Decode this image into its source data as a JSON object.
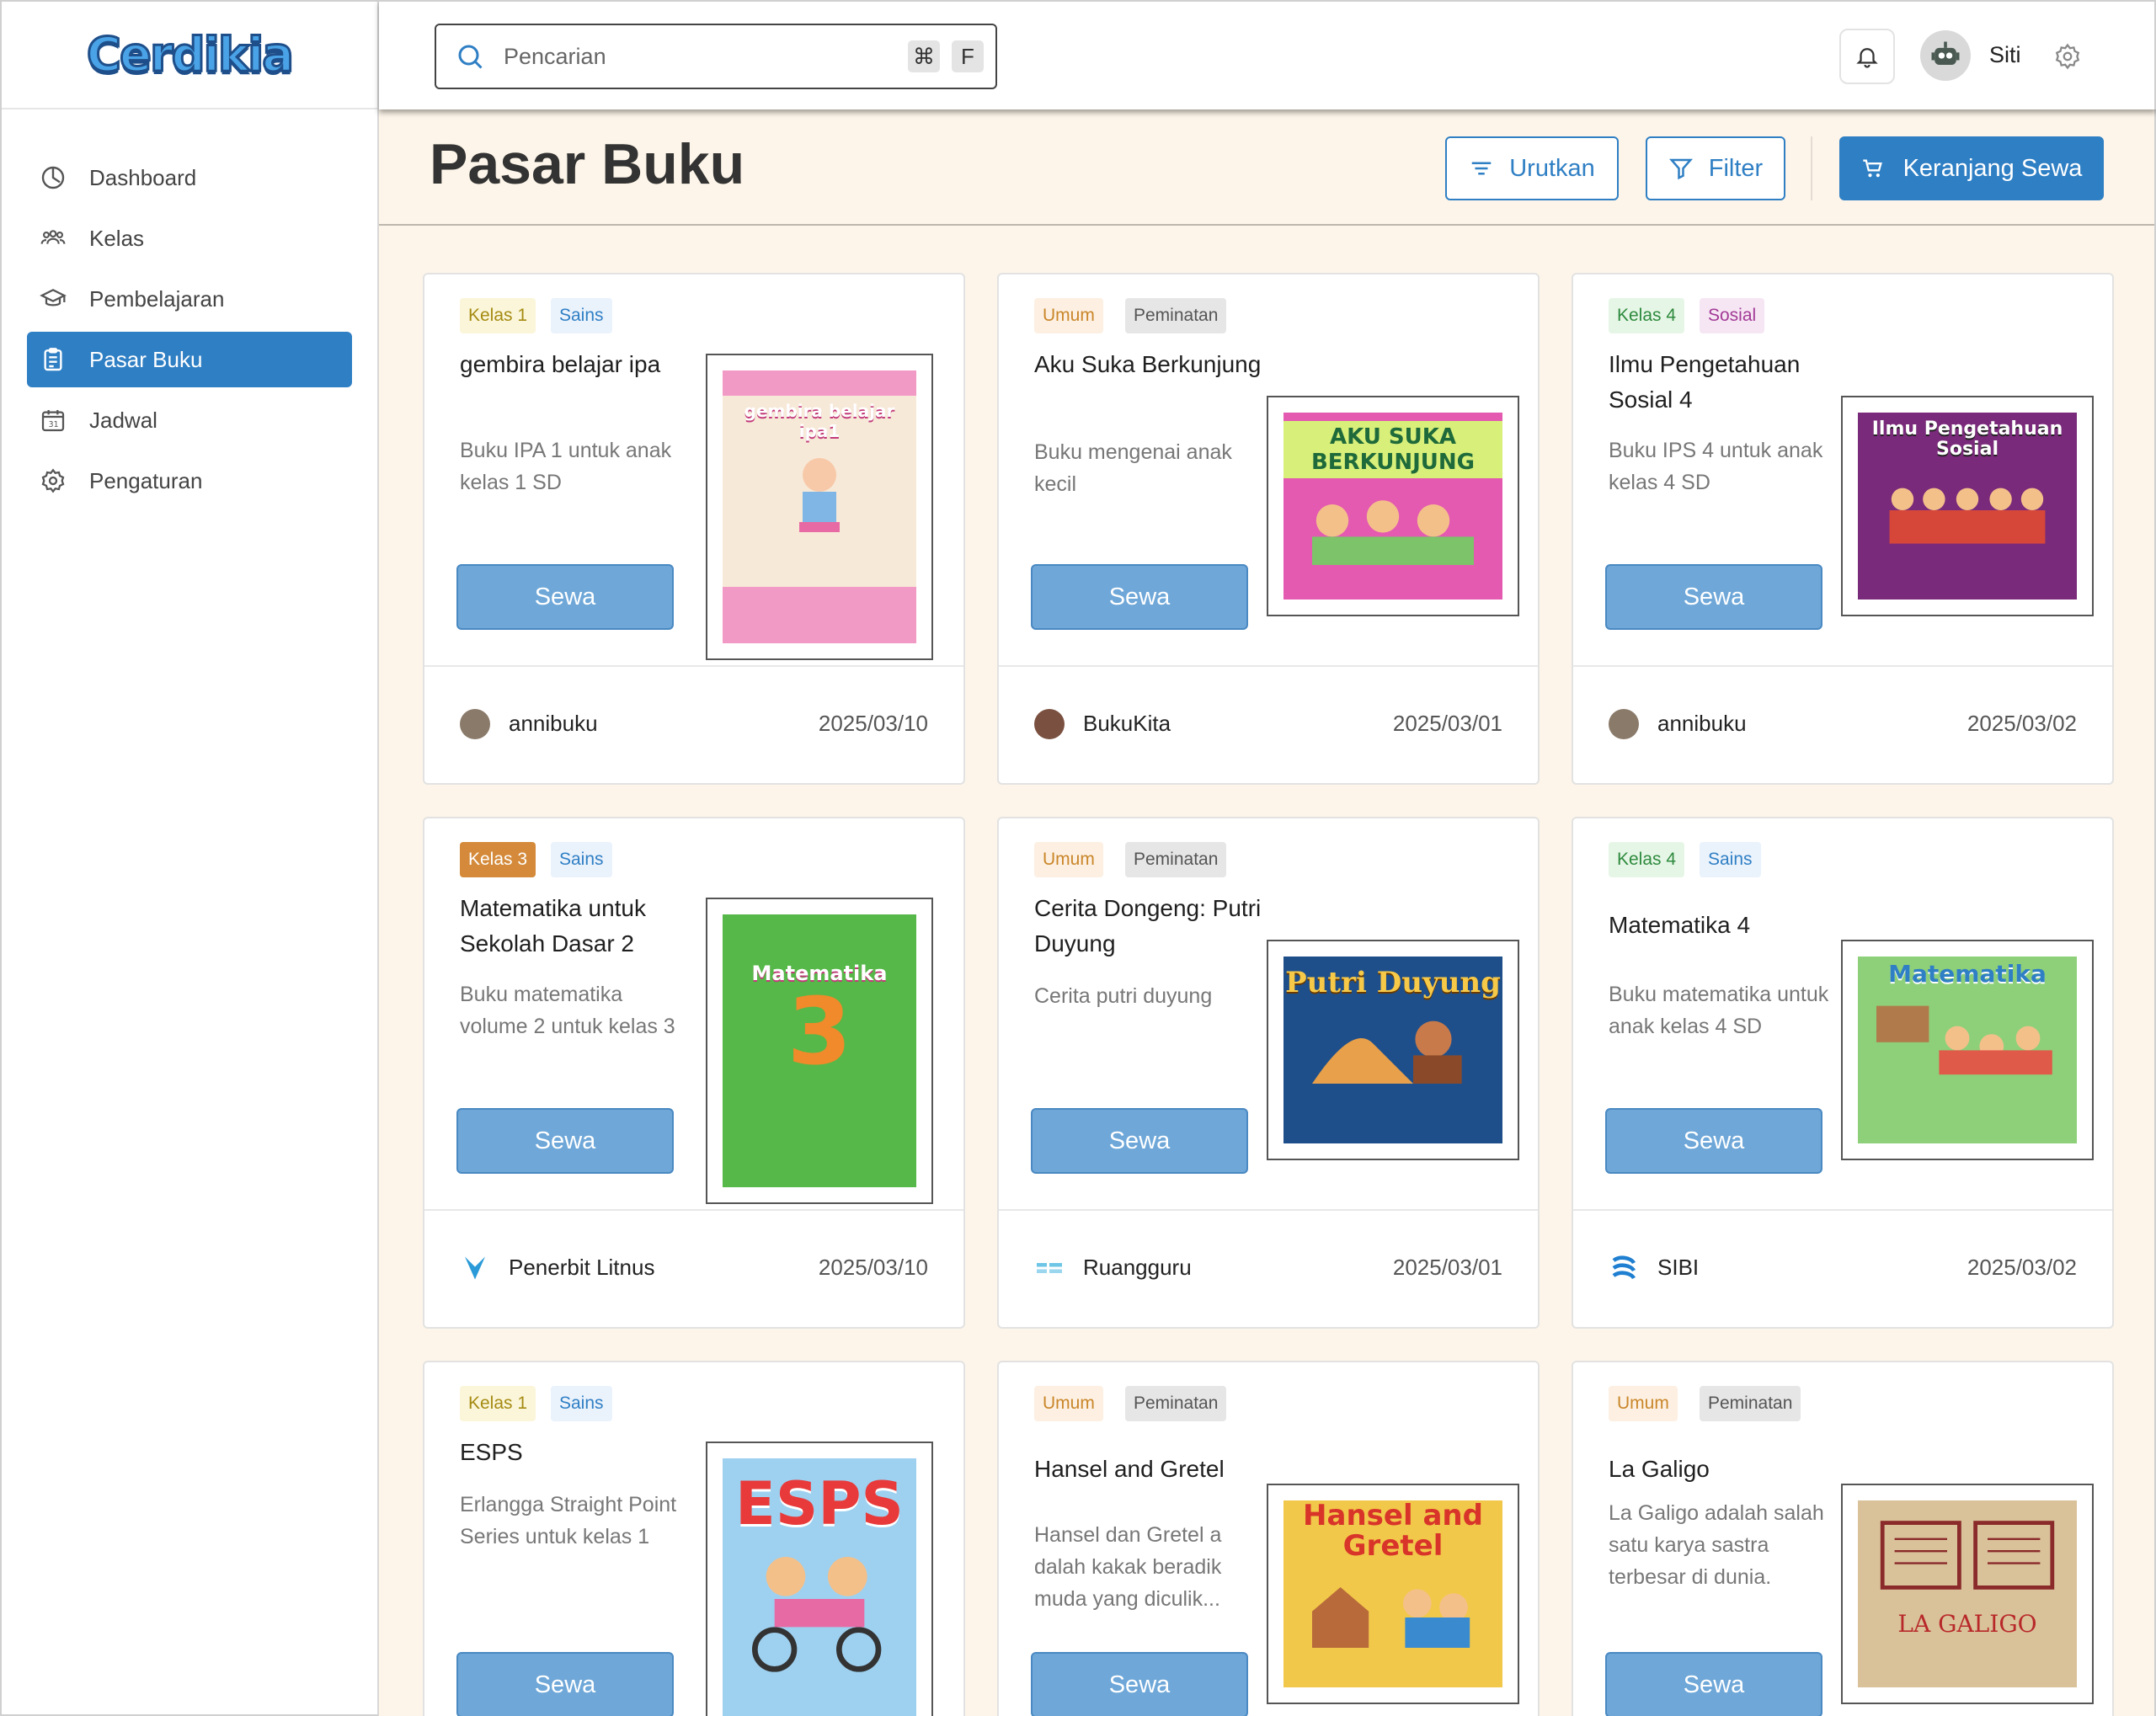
{
  "brand": {
    "logo_text": "Cerdikia"
  },
  "sidebar": {
    "items": [
      {
        "label": "Dashboard",
        "icon": "dashboard-icon"
      },
      {
        "label": "Kelas",
        "icon": "users-icon"
      },
      {
        "label": "Pembelajaran",
        "icon": "graduation-cap-icon"
      },
      {
        "label": "Pasar Buku",
        "icon": "clipboard-icon",
        "active": true
      },
      {
        "label": "Jadwal",
        "icon": "calendar-icon"
      },
      {
        "label": "Pengaturan",
        "icon": "gear-icon"
      }
    ]
  },
  "topbar": {
    "search_placeholder": "Pencarian",
    "shortcut_keys": [
      "⌘",
      "F"
    ],
    "user_name": "Siti"
  },
  "page": {
    "title": "Pasar Buku",
    "sort_label": "Urutkan",
    "filter_label": "Filter",
    "cart_label": "Keranjang Sewa"
  },
  "books": [
    {
      "tags": [
        "Kelas 1",
        "Sains"
      ],
      "title": "gembira belajar ipa",
      "desc": "Buku IPA 1 untuk anak kelas 1 SD",
      "cover_text": "gembira belajar ipa1",
      "publisher": "annibuku",
      "date": "2025/03/10",
      "action": "Sewa"
    },
    {
      "tags": [
        "Umum",
        "Peminatan"
      ],
      "title": "Aku Suka Berkunjung",
      "desc": "Buku mengenai anak kecil",
      "cover_text": "AKU SUKA BERKUNJUNG",
      "publisher": "BukuKita",
      "date": "2025/03/01",
      "action": "Sewa"
    },
    {
      "tags": [
        "Kelas 4",
        "Sosial"
      ],
      "title": "Ilmu Pengetahuan Sosial 4",
      "desc": "Buku IPS 4 untuk anak kelas 4 SD",
      "cover_text": "Ilmu Pengetahuan Sosial",
      "publisher": "annibuku",
      "date": "2025/03/02",
      "action": "Sewa"
    },
    {
      "tags": [
        "Kelas 3",
        "Sains"
      ],
      "title": "Matematika untuk Sekolah Dasar 2",
      "desc": "Buku matematika volume 2 untuk kelas 3",
      "cover_text": "Matematika",
      "publisher": "Penerbit Litnus",
      "date": "2025/03/10",
      "action": "Sewa"
    },
    {
      "tags": [
        "Umum",
        "Peminatan"
      ],
      "title": "Cerita Dongeng: Putri Duyung",
      "desc": "Cerita putri duyung",
      "cover_text": "Putri Duyung",
      "publisher": "Ruangguru",
      "date": "2025/03/01",
      "action": "Sewa"
    },
    {
      "tags": [
        "Kelas 4",
        "Sains"
      ],
      "title": "Matematika 4",
      "desc": "Buku matematika untuk anak kelas 4 SD",
      "cover_text": "Matematika",
      "publisher": "SIBI",
      "date": "2025/03/02",
      "action": "Sewa"
    },
    {
      "tags": [
        "Kelas 1",
        "Sains"
      ],
      "title": "ESPS",
      "desc": "Erlangga Straight Point Series untuk kelas 1",
      "cover_text": "ESPS",
      "publisher": "",
      "date": "",
      "action": "Sewa"
    },
    {
      "tags": [
        "Umum",
        "Peminatan"
      ],
      "title": "Hansel and Gretel",
      "desc": "Hansel dan Gretel a dalah kakak beradik muda yang diculik...",
      "cover_text": "Hansel and Gretel",
      "publisher": "",
      "date": "",
      "action": "Sewa"
    },
    {
      "tags": [
        "Umum",
        "Peminatan"
      ],
      "title": "La Galigo",
      "desc": "La Galigo adalah salah satu karya sastra terbesar di dunia.",
      "cover_text": "LA GALIGO",
      "publisher": "",
      "date": "",
      "action": "Sewa"
    }
  ],
  "colors": {
    "primary": "#2f7fc4",
    "button_rent": "#6ea7d8",
    "page_bg": "#fdf5e9"
  }
}
